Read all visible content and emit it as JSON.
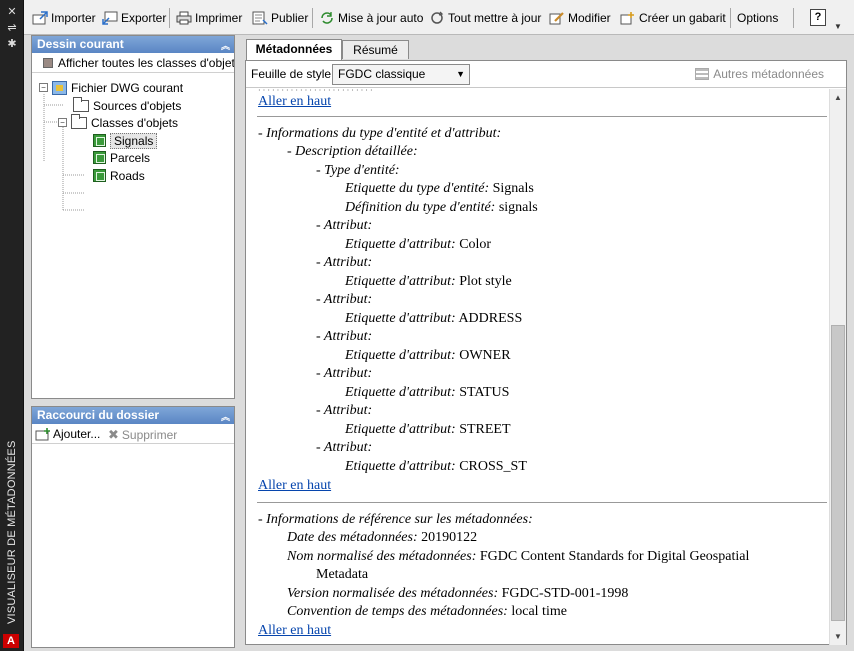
{
  "window": {
    "vertical_title": "VISUALISEUR DE MÉTADONNÉES",
    "logo": "A"
  },
  "toolbar": {
    "import": "Importer",
    "export": "Exporter",
    "print": "Imprimer",
    "publish": "Publier",
    "auto_update": "Mise à jour auto",
    "update_all": "Tout mettre à jour",
    "modify": "Modifier",
    "create_template": "Créer un gabarit",
    "options": "Options",
    "help": "?"
  },
  "current_drawing": {
    "title": "Dessin courant",
    "show_all": "Afficher toutes les classes d'objets",
    "tree": {
      "root": "Fichier DWG courant",
      "sources": "Sources d'objets",
      "classes": "Classes d'objets",
      "layers": [
        "Signals",
        "Parcels",
        "Roads"
      ]
    }
  },
  "folder_shortcut": {
    "title": "Raccourci du dossier",
    "add": "Ajouter...",
    "delete": "Supprimer"
  },
  "tabs": {
    "metadata": "Métadonnées",
    "summary": "Résumé"
  },
  "style_bar": {
    "label": "Feuille de style:",
    "selected": "FGDC classique",
    "other": "Autres métadonnées"
  },
  "doc": {
    "top_link": "Aller en haut",
    "entity_section": "- Informations du type d'entité et d'attribut:",
    "detailed_desc": "- Description détaillée:",
    "entity_type": "- Type d'entité:",
    "entity_label_key": "Etiquette du type d'entité:",
    "entity_label_val": "Signals",
    "entity_def_key": "Définition du type d'entité:",
    "entity_def_val": "signals",
    "attribute": "- Attribut:",
    "attr_label_key": "Etiquette d'attribut:",
    "attributes": [
      "Color",
      "Plot style",
      "ADDRESS",
      "OWNER",
      "STATUS",
      "STREET",
      "CROSS_ST"
    ],
    "ref_section": "- Informations de référence sur les métadonnées:",
    "date_key": "Date des métadonnées:",
    "date_val": "20190122",
    "std_name_key": "Nom normalisé des métadonnées:",
    "std_name_val": "FGDC Content Standards for Digital Geospatial",
    "std_name_val2": "Metadata",
    "std_ver_key": "Version normalisée des métadonnées:",
    "std_ver_val": "FGDC-STD-001-1998",
    "time_key": "Convention de temps des métadonnées:",
    "time_val": "local time"
  }
}
